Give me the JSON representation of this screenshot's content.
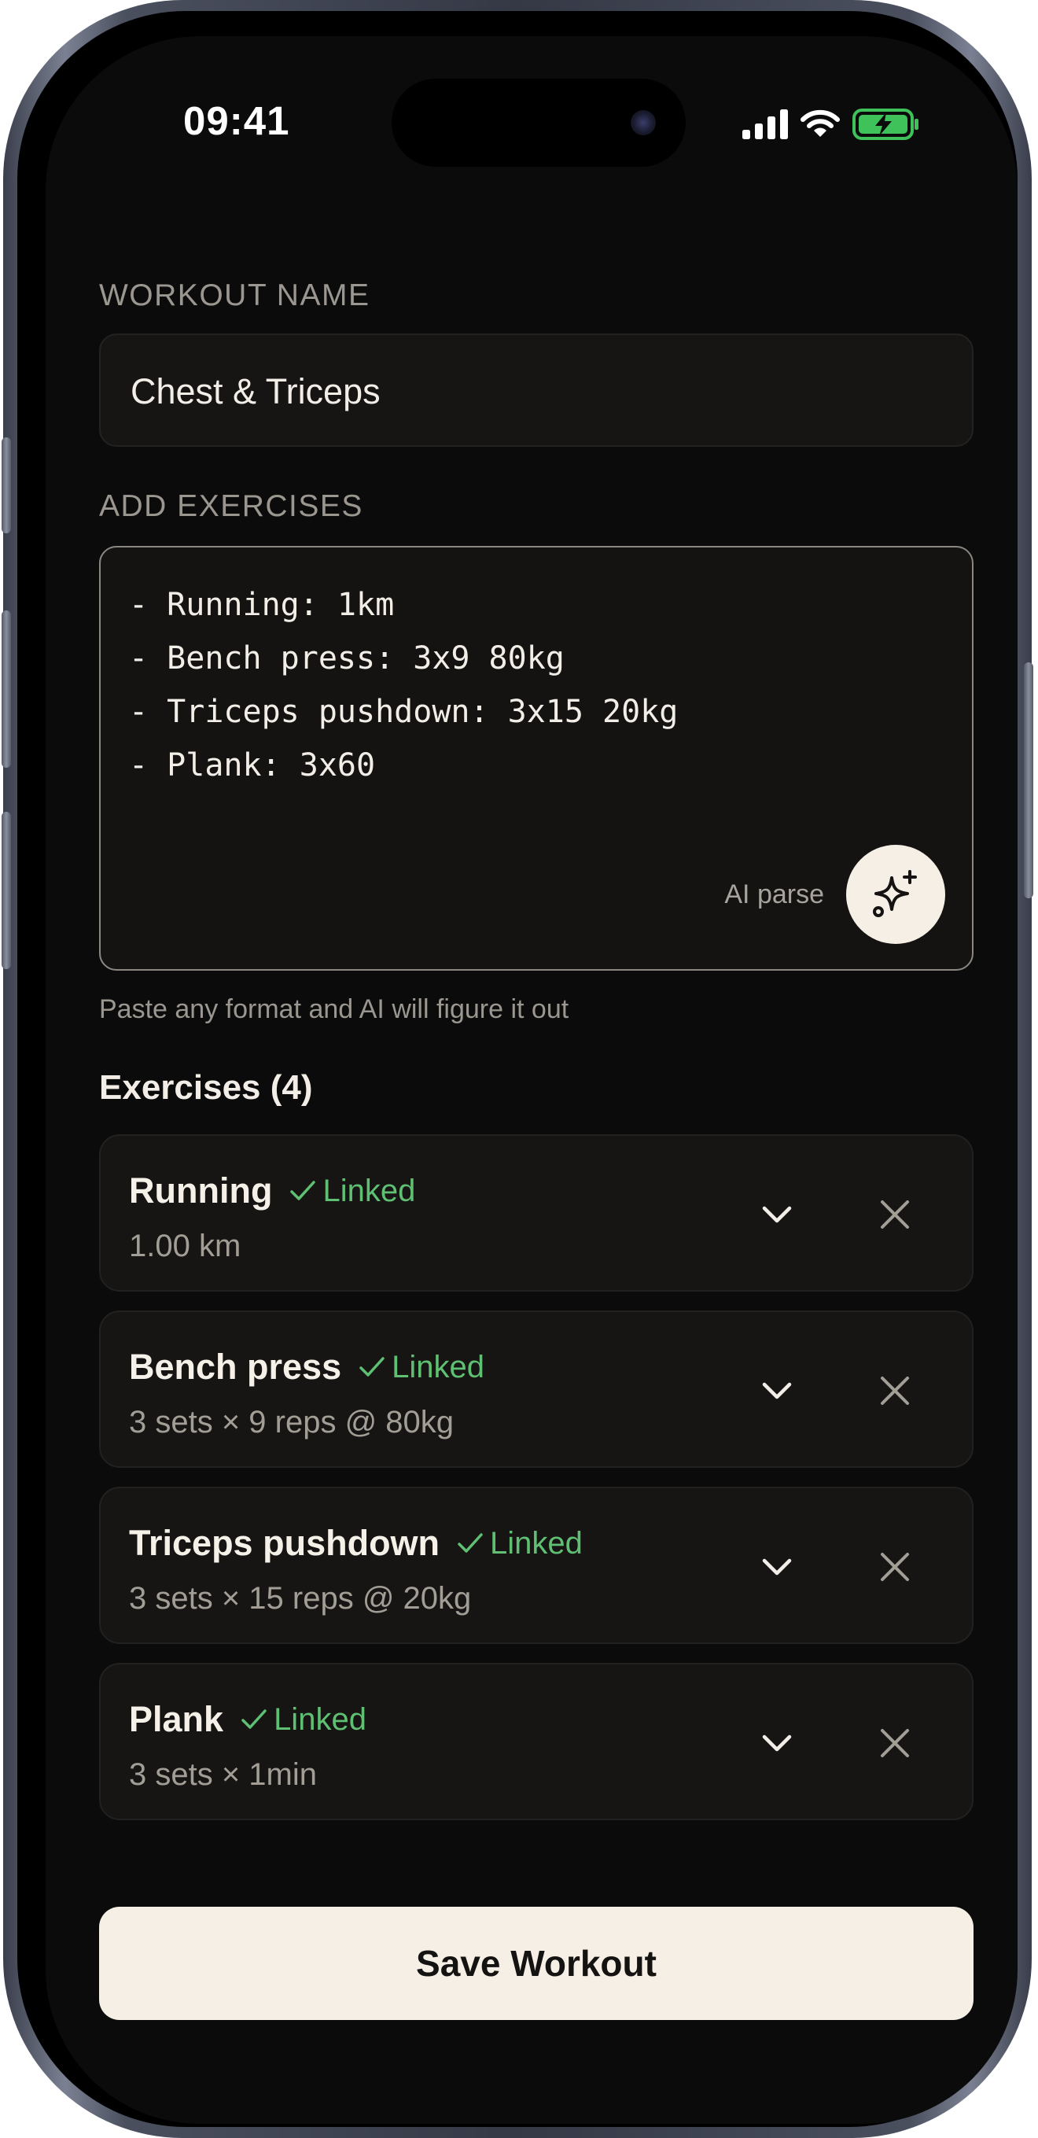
{
  "status_bar": {
    "time": "09:41",
    "icons": [
      "cellular-signal-icon",
      "wifi-icon",
      "battery-charging-icon"
    ]
  },
  "workout_name": {
    "label": "WORKOUT NAME",
    "value": "Chest & Triceps"
  },
  "add_exercises": {
    "label": "ADD EXERCISES",
    "lines": [
      "- Running: 1km",
      "- Bench press: 3x9 80kg",
      "- Triceps pushdown: 3x15 20kg",
      "- Plank: 3x60"
    ],
    "ai_parse_label": "AI parse",
    "ai_parse_icon": "sparkles-icon",
    "helper_text": "Paste any format and AI will figure it out"
  },
  "exercises": {
    "heading": "Exercises (4)",
    "items": [
      {
        "name": "Running",
        "status": "Linked",
        "detail": "1.00 km"
      },
      {
        "name": "Bench press",
        "status": "Linked",
        "detail": "3 sets × 9 reps @ 80kg"
      },
      {
        "name": "Triceps pushdown",
        "status": "Linked",
        "detail": "3 sets × 15 reps @ 20kg"
      },
      {
        "name": "Plank",
        "status": "Linked",
        "detail": "3 sets × 1min"
      }
    ]
  },
  "actions": {
    "save_label": "Save Workout"
  },
  "colors": {
    "background": "#0b0b0b",
    "card": "#161514",
    "accent_cream": "#f5efe6",
    "linked_green": "#5fbf72",
    "battery_green": "#3fc259",
    "muted_text": "#9b9790"
  }
}
